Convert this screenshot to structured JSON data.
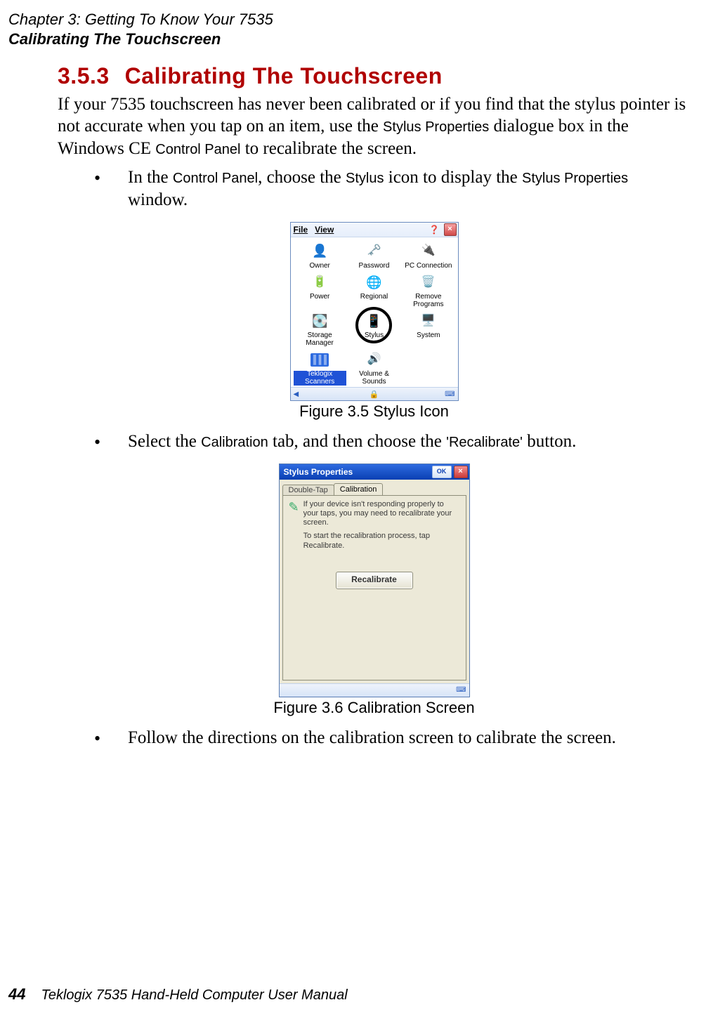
{
  "header": {
    "chapter": "Chapter 3: Getting To Know Your 7535",
    "section_title": "Calibrating The Touchscreen"
  },
  "section": {
    "number": "3.5.3",
    "title": "Calibrating The Touchscreen"
  },
  "intro": {
    "part1": "If your 7535 touchscreen has never been calibrated or if you find that the stylus pointer is not accurate when you tap on an item, use the ",
    "label1": "Stylus Properties",
    "part2": " dialogue box in the Windows CE ",
    "label2": "Control Panel",
    "part3": " to recalibrate the screen."
  },
  "bullet1": {
    "p1": "In the ",
    "l1": "Control Panel",
    "p2": ", choose the ",
    "l2": "Stylus",
    "p3": " icon to display the ",
    "l3": "Stylus Properties",
    "p4": " window."
  },
  "control_panel": {
    "menu_file": "File",
    "menu_view": "View",
    "help_glyph": "❓",
    "close_glyph": "×",
    "items": [
      {
        "label": "Owner",
        "icon": "ic-owner"
      },
      {
        "label": "Password",
        "icon": "ic-password"
      },
      {
        "label": "PC Connection",
        "icon": "ic-pc"
      },
      {
        "label": "Power",
        "icon": "ic-power"
      },
      {
        "label": "Regional",
        "icon": "ic-regional"
      },
      {
        "label": "Remove Programs",
        "icon": "ic-remove"
      },
      {
        "label": "Storage Manager",
        "icon": "ic-storage"
      },
      {
        "label": "Stylus",
        "icon": "ic-stylus"
      },
      {
        "label": "System",
        "icon": "ic-system"
      },
      {
        "label": "Teklogix Scanners",
        "icon": "ic-scan",
        "selected": true
      },
      {
        "label": "Volume & Sounds",
        "icon": "ic-volume"
      }
    ],
    "lock_glyph": "🔒",
    "key_glyph": "⌨",
    "left_glyph": "◀"
  },
  "figure1_caption": "Figure 3.5 Stylus Icon",
  "bullet2": {
    "p1": "Select the ",
    "l1": "Calibration",
    "p2": " tab, and then choose the ",
    "l2": "'Recalibrate'",
    "p3": " button."
  },
  "stylus_properties": {
    "title": "Stylus Properties",
    "ok": "OK",
    "close_glyph": "×",
    "tab_inactive": "Double-Tap",
    "tab_active": "Calibration",
    "desc1": "If your device isn't responding properly to your taps, you may need to recalibrate your screen.",
    "desc2": "To start the recalibration process, tap Recalibrate.",
    "button": "Recalibrate",
    "key_glyph": "⌨"
  },
  "figure2_caption": "Figure 3.6 Calibration Screen",
  "bullet3": "Follow the directions on the calibration screen to calibrate the screen.",
  "footer": {
    "page": "44",
    "manual": "Teklogix 7535 Hand-Held Computer User Manual"
  }
}
